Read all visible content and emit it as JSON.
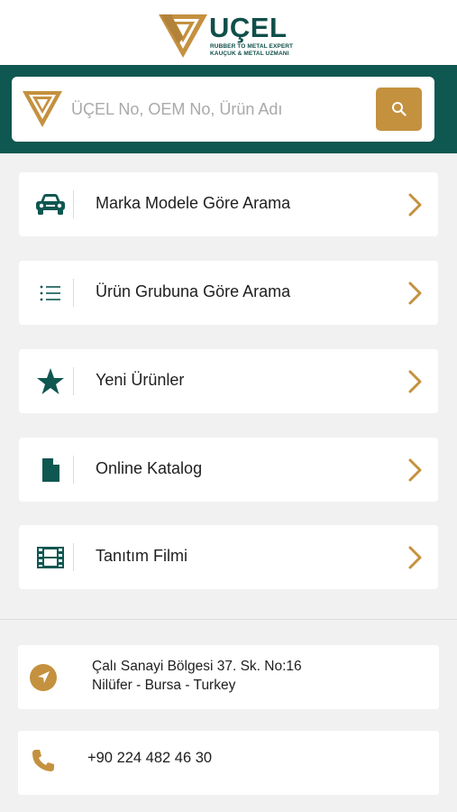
{
  "brand": {
    "name": "UÇEL",
    "tagline_en": "RUBBER TO METAL EXPERT",
    "tagline_tr": "KAUÇUK & METAL UZMANI",
    "primary_color": "#0f5751",
    "accent_color": "#c4913f"
  },
  "search": {
    "placeholder": "ÜÇEL No, OEM No, Ürün Adı",
    "value": "",
    "button_icon": "search-icon"
  },
  "menu": {
    "items": [
      {
        "label": "Marka Modele Göre Arama",
        "icon": "car-icon"
      },
      {
        "label": "Ürün Grubuna Göre Arama",
        "icon": "list-icon"
      },
      {
        "label": "Yeni Ürünler",
        "icon": "star-icon"
      },
      {
        "label": "Online Katalog",
        "icon": "document-icon"
      },
      {
        "label": "Tanıtım Filmi",
        "icon": "film-icon"
      }
    ]
  },
  "contact": {
    "address_line1": "Çalı Sanayi Bölgesi 37. Sk. No:16",
    "address_line2": "Nilüfer - Bursa - Turkey",
    "phone": "+90 224 482 46 30"
  }
}
